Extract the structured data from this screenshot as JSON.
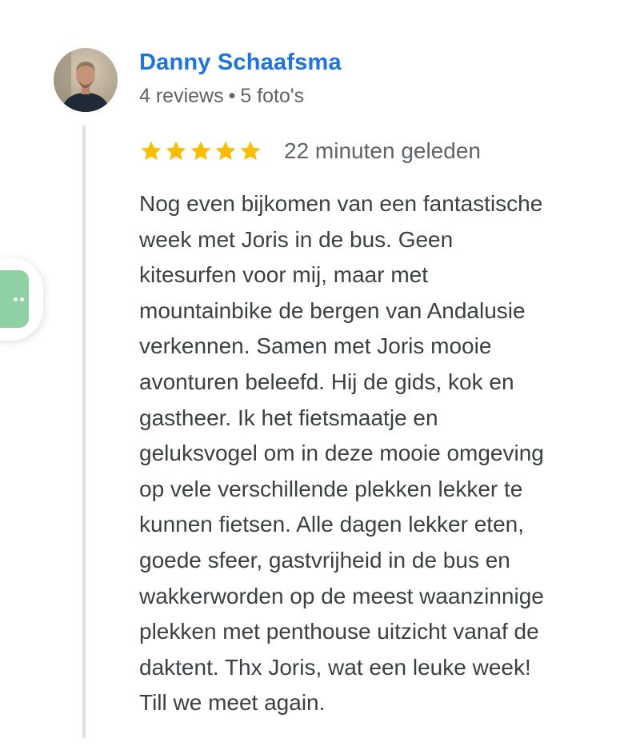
{
  "reviewer": {
    "name": "Danny Schaafsma",
    "reviews": "4 reviews",
    "separator": "•",
    "photos": "5 foto's"
  },
  "review": {
    "rating": 5,
    "rating_max": 5,
    "time": "22 minuten geleden",
    "text": "Nog even bijkomen van een fantastische\nweek met Joris in de bus. Geen\nkitesurfen voor mij, maar met\nmountainbike de bergen van Andalusie\nverkennen. Samen met Joris mooie\navonturen beleefd. Hij de gids, kok en\ngastheer. Ik het fietsmaatje en\ngeluksvogel om in deze mooie omgeving\nop vele verschillende plekken lekker te\nkunnen fietsen. Alle dagen lekker eten,\ngoede sfeer, gastvrijheid in de bus en\nwakkerworden op de meest waanzinnige\nplekken met penthouse uitzicht vanaf de\ndaktent. Thx Joris, wat een leuke week!\nTill we meet again."
  },
  "colors": {
    "name": "#1a73e8",
    "star": "#fbbc04",
    "meta": "#5f6368",
    "body": "#3c4043",
    "thread_line": "#e1e1e1",
    "floating_button": "#8fd1a5"
  },
  "icons": {
    "star": "star-icon",
    "more": "more-dots-icon"
  }
}
